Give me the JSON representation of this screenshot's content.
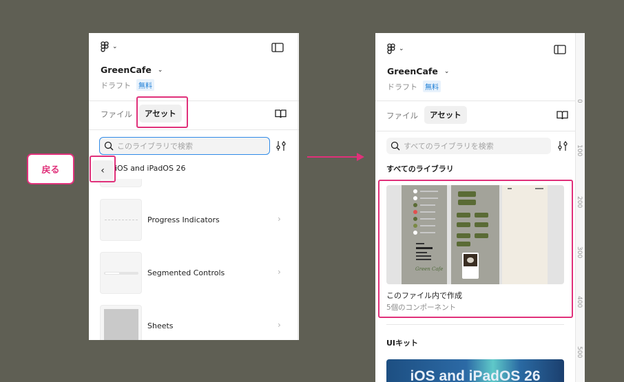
{
  "left_panel": {
    "project_name": "GreenCafe",
    "draft_label": "ドラフト",
    "plan_badge": "無料",
    "tabs": {
      "file": "ファイル",
      "assets": "アセット"
    },
    "search_placeholder": "このライブラリで検索",
    "back_title": "iOS and iPadOS 26",
    "components": [
      {
        "label": "Progress Indicators"
      },
      {
        "label": "Segmented Controls"
      },
      {
        "label": "Sheets"
      }
    ]
  },
  "callout": {
    "label": "戻る"
  },
  "right_panel": {
    "project_name": "GreenCafe",
    "draft_label": "ドラフト",
    "plan_badge": "無料",
    "tabs": {
      "file": "ファイル",
      "assets": "アセット"
    },
    "search_placeholder": "すべてのライブラリを検索",
    "all_libraries_title": "すべてのライブラリ",
    "local_library": {
      "title": "このファイル内で作成",
      "subtitle": "5個のコンポーネント",
      "preview_brand": "Green Cafe"
    },
    "ui_kit_title": "UIキット",
    "ui_kit_banner": "iOS and iPadOS 26",
    "ruler_ticks": [
      "0",
      "100",
      "200",
      "300",
      "400",
      "500"
    ]
  },
  "colors": {
    "background": "#5f5f54",
    "highlight": "#e0307a",
    "badge_blue": "#1f7fd6",
    "preview_green": "#5a6b35"
  }
}
